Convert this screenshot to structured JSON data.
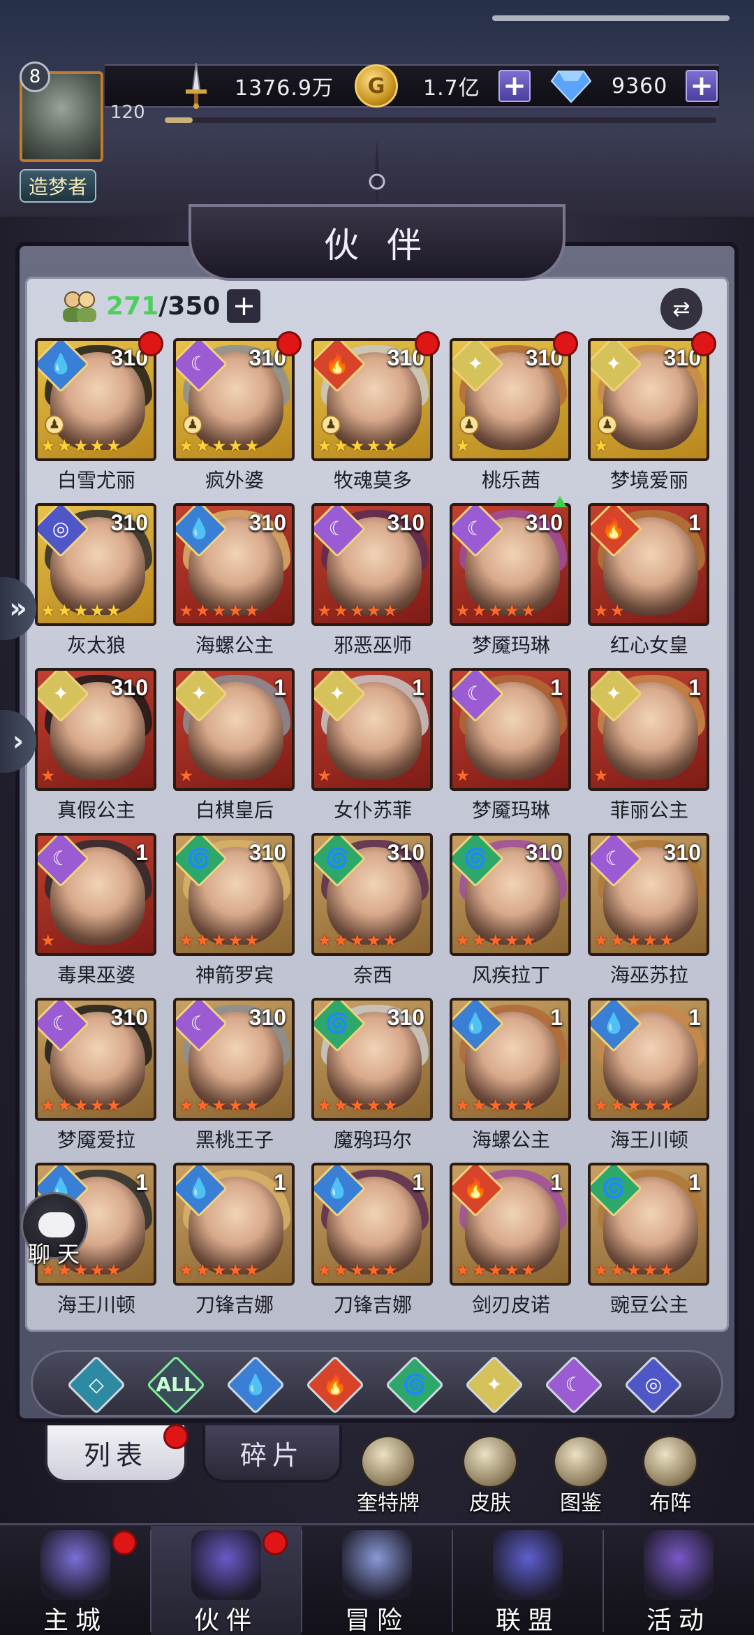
{
  "resources": {
    "power": "1376.9万",
    "gold": "1.7亿",
    "diamonds": "9360"
  },
  "player": {
    "level": "8",
    "avatar_level": "120",
    "title": "造梦者",
    "xp_fraction": 0.05
  },
  "panel": {
    "title": "伙 伴",
    "owned": "271",
    "capacity": "/350"
  },
  "heroes": [
    {
      "name": "白雪尤丽",
      "level": "310",
      "frame": "gold",
      "faction": "water",
      "stars": "yyyyy",
      "rank": true,
      "dot": true
    },
    {
      "name": "疯外婆",
      "level": "310",
      "frame": "gold",
      "faction": "moon",
      "stars": "yyyyy",
      "rank": true,
      "dot": true
    },
    {
      "name": "牧魂莫多",
      "level": "310",
      "frame": "gold",
      "faction": "fire",
      "stars": "yyyyy",
      "rank": true,
      "dot": true
    },
    {
      "name": "桃乐茜",
      "level": "310",
      "frame": "gold",
      "faction": "light",
      "stars": "y",
      "rank": true,
      "dot": true
    },
    {
      "name": "梦境爱丽",
      "level": "310",
      "frame": "gold",
      "faction": "light",
      "stars": "y",
      "rank": true,
      "dot": true
    },
    {
      "name": "灰太狼",
      "level": "310",
      "frame": "gold",
      "faction": "void",
      "stars": "yyyyy",
      "rank": false,
      "dot": false
    },
    {
      "name": "海螺公主",
      "level": "310",
      "frame": "red",
      "faction": "water",
      "stars": "rrrrr",
      "rank": false,
      "dot": false
    },
    {
      "name": "邪恶巫师",
      "level": "310",
      "frame": "red",
      "faction": "moon",
      "stars": "rrrrr",
      "rank": false,
      "dot": false
    },
    {
      "name": "梦魇玛琳",
      "level": "310",
      "frame": "red",
      "faction": "moon",
      "stars": "rrrrr",
      "rank": false,
      "dot": false,
      "up": true
    },
    {
      "name": "红心女皇",
      "level": "1",
      "frame": "red",
      "faction": "fire",
      "stars": "rr",
      "rank": false,
      "dot": false
    },
    {
      "name": "真假公主",
      "level": "310",
      "frame": "red",
      "faction": "light",
      "stars": "r",
      "rank": false,
      "dot": false
    },
    {
      "name": "白棋皇后",
      "level": "1",
      "frame": "red",
      "faction": "light",
      "stars": "r",
      "rank": false,
      "dot": false
    },
    {
      "name": "女仆苏菲",
      "level": "1",
      "frame": "red",
      "faction": "light",
      "stars": "r",
      "rank": false,
      "dot": false
    },
    {
      "name": "梦魇玛琳",
      "level": "1",
      "frame": "red",
      "faction": "moon",
      "stars": "r",
      "rank": false,
      "dot": false
    },
    {
      "name": "菲丽公主",
      "level": "1",
      "frame": "red",
      "faction": "light",
      "stars": "r",
      "rank": false,
      "dot": false
    },
    {
      "name": "毒果巫婆",
      "level": "1",
      "frame": "red",
      "faction": "moon",
      "stars": "r",
      "rank": false,
      "dot": false
    },
    {
      "name": "神箭罗宾",
      "level": "310",
      "frame": "bronze",
      "faction": "wind",
      "stars": "rrrrr",
      "rank": false,
      "dot": false
    },
    {
      "name": "奈西",
      "level": "310",
      "frame": "bronze",
      "faction": "wind",
      "stars": "rrrrr",
      "rank": false,
      "dot": false
    },
    {
      "name": "风疾拉丁",
      "level": "310",
      "frame": "bronze",
      "faction": "wind",
      "stars": "rrrrr",
      "rank": false,
      "dot": false
    },
    {
      "name": "海巫苏拉",
      "level": "310",
      "frame": "bronze",
      "faction": "moon",
      "stars": "rrrrr",
      "rank": false,
      "dot": false
    },
    {
      "name": "梦魇爱拉",
      "level": "310",
      "frame": "bronze",
      "faction": "moon",
      "stars": "rrrrr",
      "rank": false,
      "dot": false
    },
    {
      "name": "黑桃王子",
      "level": "310",
      "frame": "bronze",
      "faction": "moon",
      "stars": "rrrrr",
      "rank": false,
      "dot": false
    },
    {
      "name": "魔鸦玛尔",
      "level": "310",
      "frame": "bronze",
      "faction": "wind",
      "stars": "rrrrr",
      "rank": false,
      "dot": false
    },
    {
      "name": "海螺公主",
      "level": "1",
      "frame": "bronze",
      "faction": "water",
      "stars": "rrrrr",
      "rank": false,
      "dot": false
    },
    {
      "name": "海王川顿",
      "level": "1",
      "frame": "bronze",
      "faction": "water",
      "stars": "rrrrr",
      "rank": false,
      "dot": false
    },
    {
      "name": "海王川顿",
      "level": "1",
      "frame": "bronze",
      "faction": "water",
      "stars": "rrrrr",
      "rank": false,
      "dot": false
    },
    {
      "name": "刀锋吉娜",
      "level": "1",
      "frame": "bronze",
      "faction": "water",
      "stars": "rrrrr",
      "rank": false,
      "dot": false
    },
    {
      "name": "刀锋吉娜",
      "level": "1",
      "frame": "bronze",
      "faction": "water",
      "stars": "rrrrr",
      "rank": false,
      "dot": false
    },
    {
      "name": "剑刃皮诺",
      "level": "1",
      "frame": "bronze",
      "faction": "fire",
      "stars": "rrrrr",
      "rank": false,
      "dot": false
    },
    {
      "name": "豌豆公主",
      "level": "1",
      "frame": "bronze",
      "faction": "wind",
      "stars": "rrrrr",
      "rank": false,
      "dot": false
    }
  ],
  "faction_filters": [
    {
      "id": "all-factions",
      "label": ""
    },
    {
      "id": "all",
      "label": "ALL"
    },
    {
      "id": "water",
      "label": ""
    },
    {
      "id": "fire",
      "label": ""
    },
    {
      "id": "wind",
      "label": ""
    },
    {
      "id": "light",
      "label": ""
    },
    {
      "id": "moon",
      "label": ""
    },
    {
      "id": "void",
      "label": ""
    }
  ],
  "tabs": {
    "list": "列表",
    "fragments": "碎片"
  },
  "shortcuts": [
    {
      "id": "tarot",
      "label": "奎特牌"
    },
    {
      "id": "skin",
      "label": "皮肤"
    },
    {
      "id": "codex",
      "label": "图鉴"
    },
    {
      "id": "formation",
      "label": "布阵"
    }
  ],
  "chat": {
    "label": "聊 天"
  },
  "nav": [
    {
      "id": "castle",
      "label": "主城",
      "dot": true
    },
    {
      "id": "partners",
      "label": "伙伴",
      "dot": true,
      "active": true
    },
    {
      "id": "adventure",
      "label": "冒险",
      "dot": false
    },
    {
      "id": "alliance",
      "label": "联盟",
      "dot": false
    },
    {
      "id": "events",
      "label": "活动",
      "dot": false
    }
  ],
  "colors": {
    "water": "#3a7fd6",
    "fire": "#d8442a",
    "wind": "#2ea86a",
    "light": "#d6c25a",
    "moon": "#9b5bd3",
    "void": "#4f56c8",
    "owned_green": "#4ecf5d",
    "red_dot": "#e01616"
  }
}
